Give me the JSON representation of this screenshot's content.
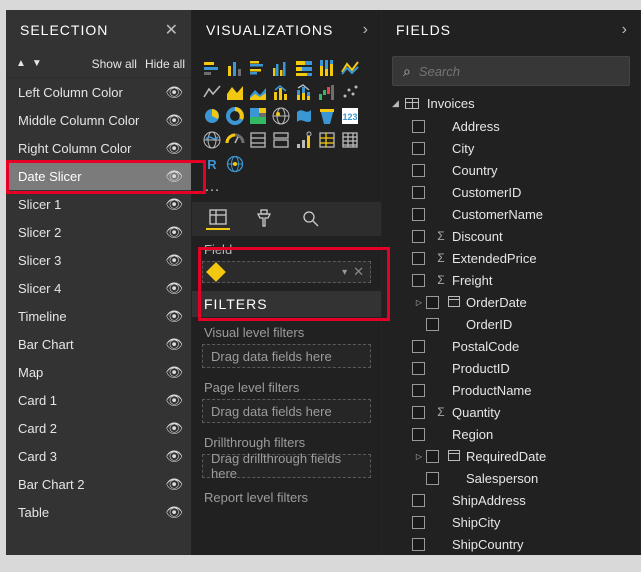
{
  "selection": {
    "title": "SELECTION",
    "show_all": "Show all",
    "hide_all": "Hide all",
    "items": [
      {
        "label": "Left Column Color",
        "selected": false
      },
      {
        "label": "Middle Column Color",
        "selected": false
      },
      {
        "label": "Right Column Color",
        "selected": false
      },
      {
        "label": "Date Slicer",
        "selected": true
      },
      {
        "label": "Slicer 1",
        "selected": false
      },
      {
        "label": "Slicer 2",
        "selected": false
      },
      {
        "label": "Slicer 3",
        "selected": false
      },
      {
        "label": "Slicer 4",
        "selected": false
      },
      {
        "label": "Timeline",
        "selected": false
      },
      {
        "label": "Bar Chart",
        "selected": false
      },
      {
        "label": "Map",
        "selected": false
      },
      {
        "label": "Card 1",
        "selected": false
      },
      {
        "label": "Card 2",
        "selected": false
      },
      {
        "label": "Card 3",
        "selected": false
      },
      {
        "label": "Bar Chart 2",
        "selected": false
      },
      {
        "label": "Table",
        "selected": false
      }
    ]
  },
  "visualizations": {
    "title": "VISUALIZATIONS",
    "field_label": "Field",
    "filters_title": "FILTERS",
    "sections": [
      {
        "label": "Visual level filters",
        "placeholder": "Drag data fields here"
      },
      {
        "label": "Page level filters",
        "placeholder": "Drag data fields here"
      },
      {
        "label": "Drillthrough filters",
        "placeholder": "Drag drillthrough fields here"
      },
      {
        "label": "Report level filters",
        "placeholder": ""
      }
    ]
  },
  "fields": {
    "title": "FIELDS",
    "search_placeholder": "Search",
    "table_name": "Invoices",
    "rows": [
      {
        "name": "Address",
        "kind": "text"
      },
      {
        "name": "City",
        "kind": "text"
      },
      {
        "name": "Country",
        "kind": "text"
      },
      {
        "name": "CustomerID",
        "kind": "text"
      },
      {
        "name": "CustomerName",
        "kind": "text"
      },
      {
        "name": "Discount",
        "kind": "sigma"
      },
      {
        "name": "ExtendedPrice",
        "kind": "sigma"
      },
      {
        "name": "Freight",
        "kind": "sigma"
      },
      {
        "name": "OrderDate",
        "kind": "calendar_expand"
      },
      {
        "name": "OrderID",
        "kind": "text",
        "nested": true
      },
      {
        "name": "PostalCode",
        "kind": "text"
      },
      {
        "name": "ProductID",
        "kind": "text"
      },
      {
        "name": "ProductName",
        "kind": "text"
      },
      {
        "name": "Quantity",
        "kind": "sigma"
      },
      {
        "name": "Region",
        "kind": "text"
      },
      {
        "name": "RequiredDate",
        "kind": "calendar_expand"
      },
      {
        "name": "Salesperson",
        "kind": "text",
        "nested": true
      },
      {
        "name": "ShipAddress",
        "kind": "text"
      },
      {
        "name": "ShipCity",
        "kind": "text"
      },
      {
        "name": "ShipCountry",
        "kind": "text"
      }
    ]
  },
  "icons": {
    "viz_names": [
      "stacked-bar",
      "stacked-column",
      "clustered-bar",
      "clustered-column",
      "100-stacked-bar",
      "100-stacked-column",
      "ribbon",
      "line",
      "area",
      "stacked-area",
      "line-clustered-column",
      "line-stacked-column",
      "waterfall",
      "scatter",
      "pie",
      "donut",
      "treemap",
      "map",
      "filled-map",
      "funnel",
      "gauge",
      "card",
      "multi-row-card",
      "kpi",
      "slicer",
      "table",
      "matrix",
      "r-visual",
      "arcgis",
      "globe"
    ]
  }
}
